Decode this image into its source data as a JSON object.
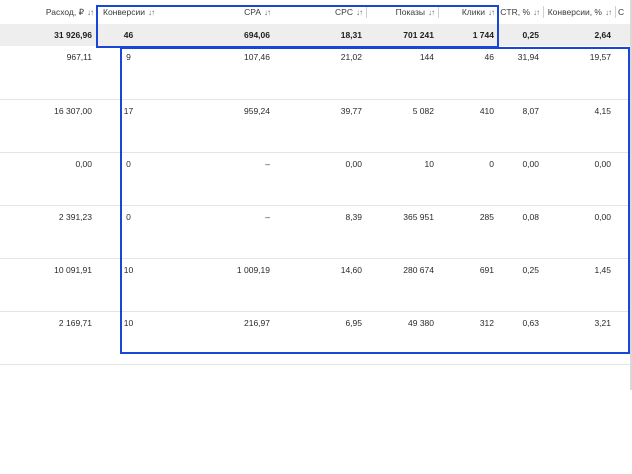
{
  "columns": [
    {
      "key": "spend",
      "label": "Расход, ₽",
      "sort": "↓↑"
    },
    {
      "key": "conversions",
      "label": "Конверсии",
      "sort": "↓↑"
    },
    {
      "key": "cpa",
      "label": "CPA",
      "sort": "↓↑"
    },
    {
      "key": "cpc",
      "label": "CPC",
      "sort": "↓↑"
    },
    {
      "key": "impressions",
      "label": "Показы",
      "sort": "↓↑"
    },
    {
      "key": "clicks",
      "label": "Клики",
      "sort": "↓↑"
    },
    {
      "key": "ctr",
      "label": "CTR, %",
      "sort": "↓↑"
    },
    {
      "key": "conv_rate",
      "label": "Конверсии, %",
      "sort": "↓↑"
    },
    {
      "key": "next",
      "label": "С",
      "sort": ""
    }
  ],
  "totals": [
    "31 926,96",
    "46",
    "694,06",
    "18,31",
    "701 241",
    "1 744",
    "0,25",
    "2,64",
    ""
  ],
  "rows": [
    [
      "967,11",
      "9",
      "107,46",
      "21,02",
      "144",
      "46",
      "31,94",
      "19,57",
      ""
    ],
    [
      "16 307,00",
      "17",
      "959,24",
      "39,77",
      "5 082",
      "410",
      "8,07",
      "4,15",
      ""
    ],
    [
      "0,00",
      "0",
      "–",
      "0,00",
      "10",
      "0",
      "0,00",
      "0,00",
      ""
    ],
    [
      "2 391,23",
      "0",
      "–",
      "8,39",
      "365 951",
      "285",
      "0,08",
      "0,00",
      ""
    ],
    [
      "10 091,91",
      "10",
      "1 009,19",
      "14,60",
      "280 674",
      "691",
      "0,25",
      "1,45",
      ""
    ],
    [
      "2 169,71",
      "10",
      "216,97",
      "6,95",
      "49 380",
      "312",
      "0,63",
      "3,21",
      ""
    ]
  ],
  "highlight_color": "#1846d6"
}
